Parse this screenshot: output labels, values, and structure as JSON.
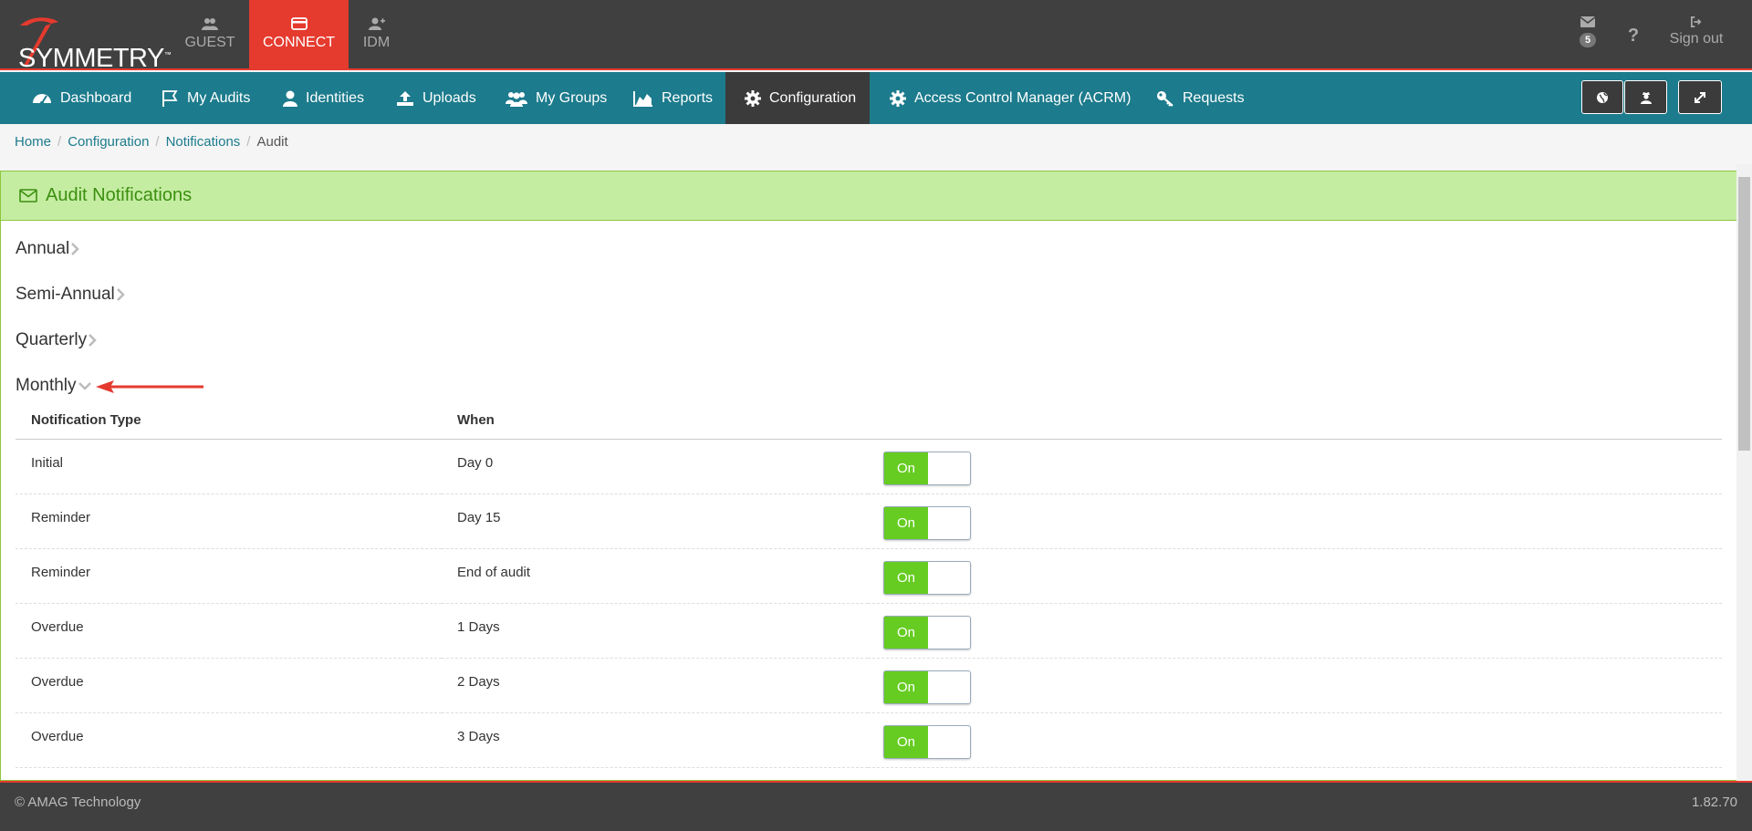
{
  "brand": {
    "name": "SYMMETRY",
    "tm": "™"
  },
  "app_tabs": [
    {
      "label": "GUEST",
      "icon": "users-icon"
    },
    {
      "label": "CONNECT",
      "icon": "card-icon"
    },
    {
      "label": "IDM",
      "icon": "user-plus-icon"
    }
  ],
  "top_right": {
    "messages_icon": "envelope-icon",
    "messages_count": "5",
    "help_label": "?",
    "signout_label": "Sign out"
  },
  "nav": {
    "items": [
      {
        "label": "Dashboard",
        "icon": "dashboard-icon"
      },
      {
        "label": "My Audits",
        "icon": "flag-icon"
      },
      {
        "label": "Identities",
        "icon": "user-icon"
      },
      {
        "label": "Uploads",
        "icon": "upload-icon"
      },
      {
        "label": "My Groups",
        "icon": "group-icon"
      },
      {
        "label": "Reports",
        "icon": "area-chart-icon"
      },
      {
        "label": "Configuration",
        "icon": "gear-icon"
      },
      {
        "label": "Access Control Manager (ACRM)",
        "icon": "gear-icon"
      },
      {
        "label": "Requests",
        "icon": "key-icon"
      }
    ],
    "active": "Configuration"
  },
  "breadcrumb": [
    "Home",
    "Configuration",
    "Notifications",
    "Audit"
  ],
  "panel": {
    "title": "Audit Notifications",
    "sections": [
      "Annual",
      "Semi-Annual",
      "Quarterly",
      "Monthly"
    ],
    "expanded": "Monthly"
  },
  "table": {
    "headers": [
      "Notification Type",
      "When"
    ],
    "rows": [
      {
        "type": "Initial",
        "when": "Day 0",
        "toggle": "On"
      },
      {
        "type": "Reminder",
        "when": "Day 15",
        "toggle": "On"
      },
      {
        "type": "Reminder",
        "when": "End of audit",
        "toggle": "On"
      },
      {
        "type": "Overdue",
        "when": "1 Days",
        "toggle": "On"
      },
      {
        "type": "Overdue",
        "when": "2 Days",
        "toggle": "On"
      },
      {
        "type": "Overdue",
        "when": "3 Days",
        "toggle": "On"
      }
    ]
  },
  "footer": {
    "copyright": "© AMAG Technology",
    "version": "1.82.70"
  },
  "colors": {
    "accent_red": "#e53a2e",
    "nav_teal": "#1c7b8c",
    "toggle_green": "#66cc22",
    "panel_green": "#c5eda2"
  }
}
